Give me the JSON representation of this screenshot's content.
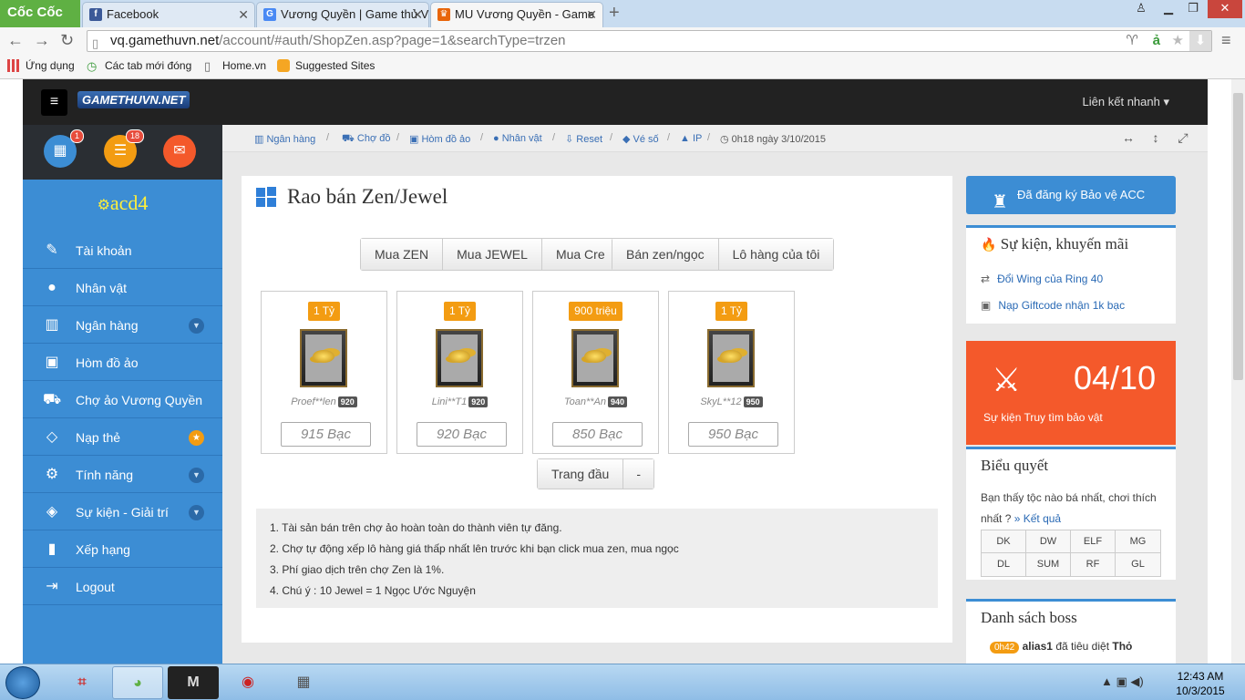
{
  "browser": {
    "brand": "Cốc Cốc",
    "tabs": [
      {
        "title": "Facebook",
        "icon": "facebook-icon"
      },
      {
        "title": "Vương Quyền | Game thủ V",
        "icon": "google-icon"
      },
      {
        "title": "MU Vương Quyền - Game",
        "icon": "mu-icon"
      }
    ],
    "url_host": "vq.gamethuvn.net",
    "url_path": "/account/#auth/ShopZen.asp?page=1&searchType=trzen",
    "bookmarks": [
      "Ứng dụng",
      "Các tab mới đóng",
      "Home.vn",
      "Suggested Sites"
    ]
  },
  "site": {
    "logo": "GAMETHUVN.NET",
    "quick_links": "Liên kết nhanh",
    "badges": {
      "calendar": "1",
      "list": "18"
    },
    "username": "acd4",
    "menu": [
      {
        "label": "Tài khoản",
        "icon": "edit-icon",
        "extra": ""
      },
      {
        "label": "Nhân vật",
        "icon": "user-icon",
        "extra": ""
      },
      {
        "label": "Ngân hàng",
        "icon": "bank-icon",
        "extra": "chevron"
      },
      {
        "label": "Hòm đồ ảo",
        "icon": "briefcase-icon",
        "extra": ""
      },
      {
        "label": "Chợ ảo Vương Quyền",
        "icon": "cart-icon",
        "extra": ""
      },
      {
        "label": "Nạp thẻ",
        "icon": "diamond-icon",
        "extra": "star"
      },
      {
        "label": "Tính năng",
        "icon": "gears-icon",
        "extra": "chevron"
      },
      {
        "label": "Sự kiện - Giải trí",
        "icon": "ring-icon",
        "extra": "chevron"
      },
      {
        "label": "Xếp hạng",
        "icon": "chart-icon",
        "extra": ""
      },
      {
        "label": "Logout",
        "icon": "logout-icon",
        "extra": ""
      }
    ],
    "breadcrumb": [
      "Ngân hàng",
      "Chợ đồ",
      "Hòm đồ ảo",
      "Nhân vật",
      "Reset",
      "Vé số",
      "IP"
    ],
    "time_text": "0h18 ngày 3/10/2015"
  },
  "main": {
    "title": "Rao bán Zen/Jewel",
    "buttons_left": [
      "Mua ZEN",
      "Mua JEWEL",
      "Mua Cre"
    ],
    "buttons_right": [
      "Bán zen/ngọc",
      "Lô hàng của tôi"
    ],
    "items": [
      {
        "price": "1 Tỷ",
        "seller": "Proef**len",
        "level": "920",
        "amount": "915 Bạc"
      },
      {
        "price": "1 Tỷ",
        "seller": "Lini**T1",
        "level": "920",
        "amount": "920 Bạc"
      },
      {
        "price": "900 triệu",
        "seller": "Toan**An",
        "level": "940",
        "amount": "850 Bạc"
      },
      {
        "price": "1 Tỷ",
        "seller": "SkyL**12",
        "level": "950",
        "amount": "950 Bạc"
      }
    ],
    "pager": [
      "Trang đầu",
      "-"
    ],
    "notes": [
      "1. Tài sản bán trên chợ ảo hoàn toàn do thành viên tự đăng.",
      "2. Chợ tự động xếp lô hàng giá thấp nhất lên trước khi bạn click mua zen, mua ngọc",
      "3. Phí giao dịch trên chợ Zen là 1%.",
      "4. Chú ý : 10 Jewel = 1 Ngọc Ước Nguyện"
    ]
  },
  "sidebar_right": {
    "protect": "Đã đăng ký Bảo vệ ACC",
    "events_title": "Sự kiện, khuyến mãi",
    "events": [
      "Đổi Wing của Ring 40",
      "Nạp Giftcode nhận 1k bạc"
    ],
    "hunt_count": "04/10",
    "hunt_label": "Sự kiện Truy tìm bảo vật",
    "vote_title": "Biểu quyết",
    "vote_question": "Bạn thấy tộc nào bá nhất, chơi thích nhất ?",
    "vote_result": "» Kết quả",
    "vote_options": [
      "DK",
      "DW",
      "ELF",
      "MG",
      "DL",
      "SUM",
      "RF",
      "GL"
    ],
    "boss_title": "Danh sách boss",
    "boss_time": "0h42",
    "boss_player": "alias1",
    "boss_action": "đã tiêu diệt",
    "boss_name": "Thỏ"
  },
  "taskbar": {
    "time": "12:43 AM",
    "date": "10/3/2015"
  }
}
